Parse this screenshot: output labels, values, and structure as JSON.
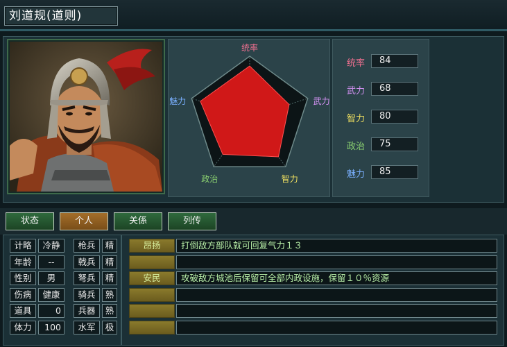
{
  "title": "刘道规(道则)",
  "radar": {
    "axes": [
      "统率",
      "武力",
      "智力",
      "政治",
      "魅力"
    ],
    "axis_colors": [
      "#f07090",
      "#d090f0",
      "#f0e060",
      "#8ad070",
      "#7ab0ff"
    ],
    "values": [
      84,
      68,
      80,
      75,
      85
    ],
    "max": 100
  },
  "stats": [
    {
      "label": "统率",
      "value": "84",
      "color": "#f07090"
    },
    {
      "label": "武力",
      "value": "68",
      "color": "#d090f0"
    },
    {
      "label": "智力",
      "value": "80",
      "color": "#f0e060"
    },
    {
      "label": "政治",
      "value": "75",
      "color": "#8ad070"
    },
    {
      "label": "魅力",
      "value": "85",
      "color": "#7ab0ff"
    }
  ],
  "tabs": [
    "状态",
    "个人",
    "关係",
    "列传"
  ],
  "active_tab": "个人",
  "info": [
    {
      "label": "计略",
      "value": "冷静"
    },
    {
      "label": "年龄",
      "value": "--"
    },
    {
      "label": "性别",
      "value": "男"
    },
    {
      "label": "伤病",
      "value": "健康"
    },
    {
      "label": "道具",
      "value": "0"
    },
    {
      "label": "体力",
      "value": "100"
    }
  ],
  "troops": [
    {
      "label": "枪兵",
      "value": "精"
    },
    {
      "label": "戟兵",
      "value": "精"
    },
    {
      "label": "弩兵",
      "value": "精"
    },
    {
      "label": "骑兵",
      "value": "熟"
    },
    {
      "label": "兵器",
      "value": "熟"
    },
    {
      "label": "水军",
      "value": "极"
    }
  ],
  "skills": [
    {
      "name": "昂扬",
      "desc": "打倒敌方部队就可回复气力１３"
    },
    {
      "name": "",
      "desc": ""
    },
    {
      "name": "安民",
      "desc": "攻破敌方城池后保留可全部内政设施，保留１０％资源"
    },
    {
      "name": "",
      "desc": ""
    },
    {
      "name": "",
      "desc": ""
    },
    {
      "name": "",
      "desc": ""
    }
  ]
}
